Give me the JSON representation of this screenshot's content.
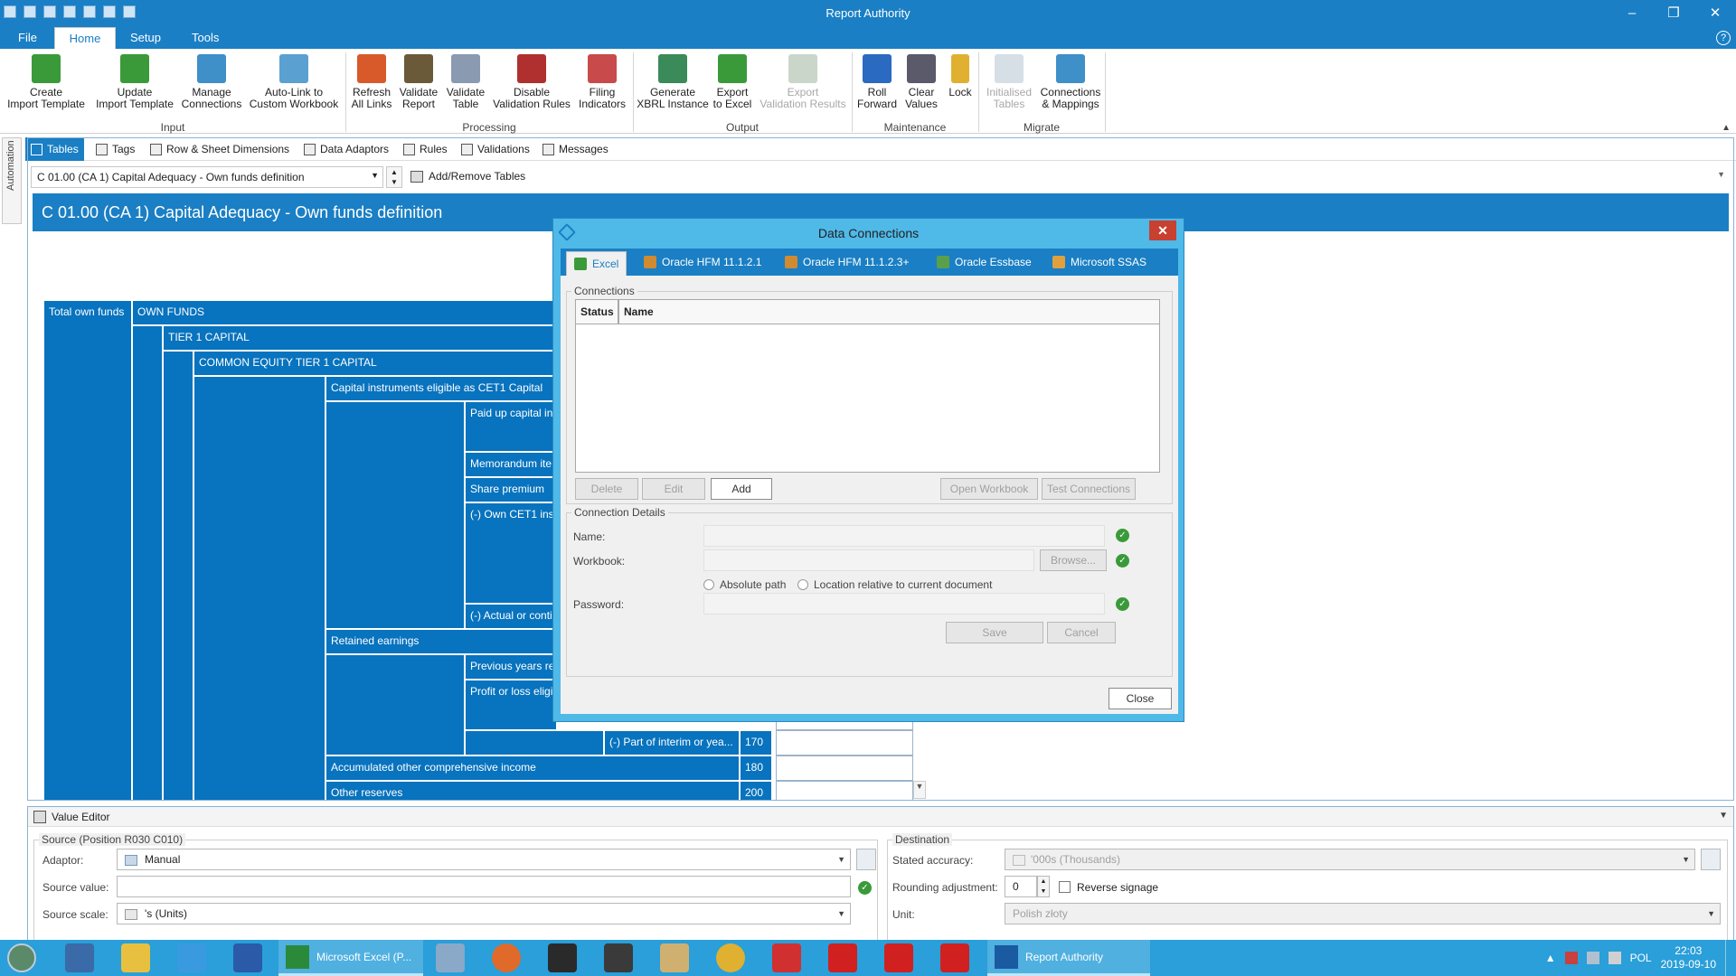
{
  "app": {
    "title": "Report Authority"
  },
  "menu": {
    "file": "File",
    "home": "Home",
    "setup": "Setup",
    "tools": "Tools",
    "help": "?"
  },
  "ribbon": {
    "buttons": [
      {
        "l1": "Create",
        "l2": "Import Template"
      },
      {
        "l1": "Update",
        "l2": "Import Template"
      },
      {
        "l1": "Manage",
        "l2": "Connections"
      },
      {
        "l1": "Auto-Link to",
        "l2": "Custom Workbook"
      },
      {
        "l1": "Refresh",
        "l2": "All Links"
      },
      {
        "l1": "Validate",
        "l2": "Report"
      },
      {
        "l1": "Validate",
        "l2": "Table"
      },
      {
        "l1": "Disable",
        "l2": "Validation Rules"
      },
      {
        "l1": "Filing",
        "l2": "Indicators"
      },
      {
        "l1": "Generate",
        "l2": "XBRL Instance"
      },
      {
        "l1": "Export",
        "l2": "to Excel"
      },
      {
        "l1": "Export",
        "l2": "Validation Results"
      },
      {
        "l1": "Roll",
        "l2": "Forward"
      },
      {
        "l1": "Clear",
        "l2": "Values"
      },
      {
        "l1": "Lock",
        "l2": ""
      },
      {
        "l1": "Initialised",
        "l2": "Tables"
      },
      {
        "l1": "Connections",
        "l2": "& Mappings"
      }
    ],
    "groups": [
      "Input",
      "Processing",
      "Output",
      "Maintenance",
      "Migrate"
    ]
  },
  "automation": "Automation",
  "viewtabs": [
    "Tables",
    "Tags",
    "Row & Sheet Dimensions",
    "Data Adaptors",
    "Rules",
    "Validations",
    "Messages"
  ],
  "selector": {
    "value": "C 01.00 (CA 1) Capital Adequacy - Own funds definition",
    "addremove": "Add/Remove Tables"
  },
  "sheet": {
    "title": "C 01.00 (CA 1) Capital Adequacy - Own funds definition",
    "rows": {
      "total": "Total own funds",
      "own": "OWN FUNDS",
      "tier1": "TIER 1 CAPITAL",
      "cet1": "COMMON EQUITY TIER 1 CAPITAL",
      "capinst": "Capital instruments eligible as CET1 Capital",
      "paidup": "Paid up capital in",
      "memo": "Memorandum ite",
      "share": "Share premium",
      "owncet1": "(-) Own CET1 inst",
      "actual": "(-) Actual or conti",
      "retained": "Retained earnings",
      "prevyears": "Previous years ret",
      "profitloss": "Profit or loss eligi",
      "partinterim": "(-) Part of interim or yea...",
      "aoci": "Accumulated other comprehensive income",
      "otherres": "Other reserves"
    },
    "codes": {
      "r170": "170",
      "r180": "180",
      "r200": "200"
    }
  },
  "dialog": {
    "title": "Data Connections",
    "tabs": [
      "Excel",
      "Oracle HFM 11.1.2.1",
      "Oracle HFM 11.1.2.3+",
      "Oracle Essbase",
      "Microsoft SSAS"
    ],
    "connections_label": "Connections",
    "cols": {
      "status": "Status",
      "name": "Name"
    },
    "buttons": {
      "delete": "Delete",
      "edit": "Edit",
      "add": "Add",
      "openwb": "Open Workbook",
      "test": "Test Connections",
      "browse": "Browse...",
      "save": "Save",
      "cancel": "Cancel",
      "close": "Close"
    },
    "details_label": "Connection Details",
    "fields": {
      "name": "Name:",
      "workbook": "Workbook:",
      "password": "Password:",
      "absolute": "Absolute path",
      "relative": "Location relative to current document"
    }
  },
  "value_editor": {
    "title": "Value Editor",
    "source_label": "Source (Position R030 C010)",
    "adaptor_label": "Adaptor:",
    "adaptor_value": "Manual",
    "source_value_label": "Source value:",
    "source_value": "",
    "source_scale_label": "Source scale:",
    "source_scale_value": "'s (Units)",
    "destination_label": "Destination",
    "accuracy_label": "Stated accuracy:",
    "accuracy_value": "'000s (Thousands)",
    "rounding_label": "Rounding adjustment:",
    "rounding_value": "0",
    "reverse_label": "Reverse signage",
    "unit_label": "Unit:",
    "unit_value": "Polish złoty"
  },
  "taskbar": {
    "excel_label": "Microsoft Excel (P...",
    "ra_label": "Report Authority",
    "lang": "POL",
    "time": "22:03",
    "date": "2019-09-10"
  },
  "colors": {
    "accent": "#1a7fc4",
    "grid_blue": "#0873be",
    "dialog_frame": "#4fb9e8",
    "ok_green": "#3a9a3a",
    "close_red": "#c84030"
  }
}
